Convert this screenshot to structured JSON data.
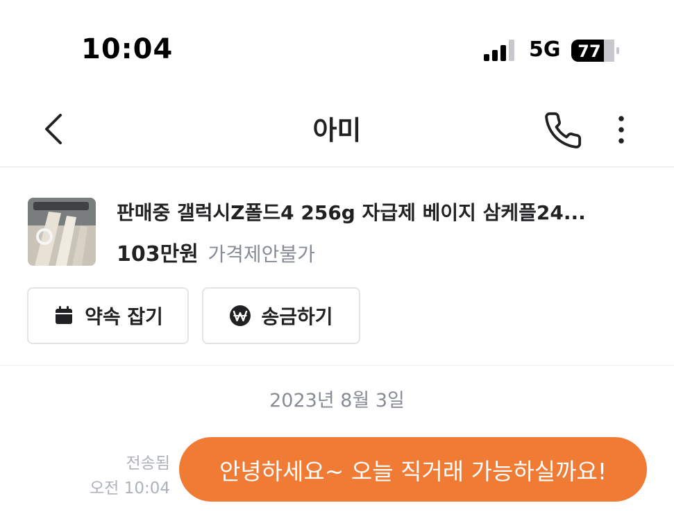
{
  "status_bar": {
    "time": "10:04",
    "network": "5G",
    "battery": "77",
    "signal_icon": "signal-bars-icon",
    "battery_icon": "battery-icon"
  },
  "nav": {
    "title": "아미",
    "back_icon": "chevron-left-icon",
    "call_icon": "phone-icon",
    "more_icon": "more-vertical-icon"
  },
  "product": {
    "title": "판매중 갤럭시Z폴드4 256g 자급제 베이지 삼케플24...",
    "price": "103만원",
    "price_note": "가격제안불가"
  },
  "actions": [
    {
      "label": "약속 잡기",
      "icon": "calendar-icon"
    },
    {
      "label": "송금하기",
      "icon": "won-coin-icon"
    }
  ],
  "chat": {
    "date": "2023년 8월 3일",
    "messages": [
      {
        "status": "전송됨",
        "time": "오전 10:04",
        "text": "안녕하세요~ 오늘 직거래 가능하실까요!"
      }
    ]
  },
  "colors": {
    "accent": "#ef7b35",
    "text_primary": "#212124",
    "text_secondary": "#868b94",
    "border": "#e2e4e8"
  }
}
